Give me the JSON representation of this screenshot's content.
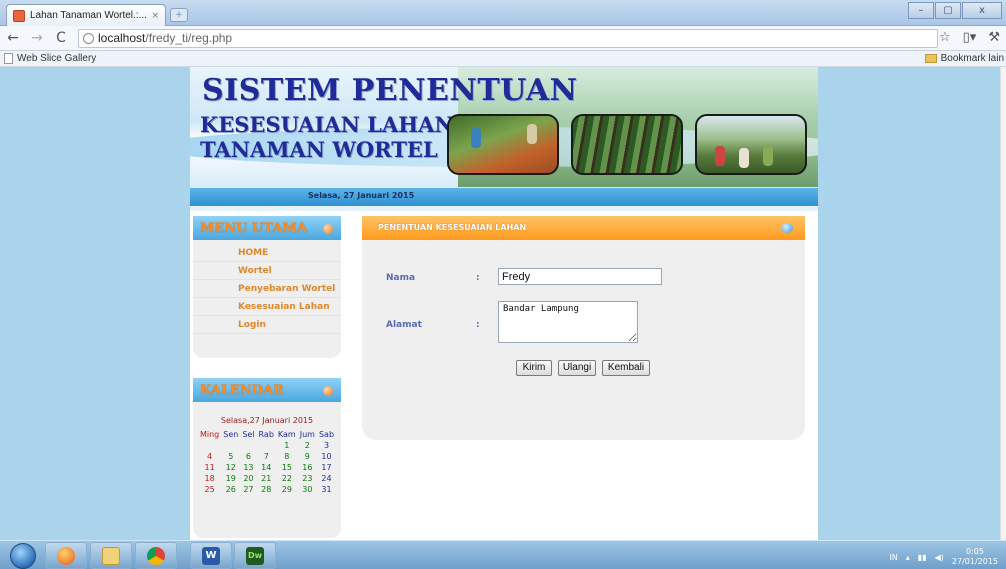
{
  "browser": {
    "tab_title": "Lahan Tanaman Wortel.:...",
    "tab_close": "×",
    "new_tab": "+",
    "window_controls": [
      "–",
      "▢",
      "x"
    ],
    "url_host": "localhost",
    "url_path": "/fredy_ti/reg.php",
    "bookmark_left": "Web Slice Gallery",
    "bookmark_right": "Bookmark lain"
  },
  "banner": {
    "title_line1": "SISTEM PENENTUAN",
    "title_line2": "KESESUAIAN LAHAN",
    "title_line3": "TANAMAN WORTEL",
    "date": "Selasa, 27 Januari 2015"
  },
  "menu": {
    "heading": "MENU UTAMA",
    "items": [
      {
        "label": "HOME"
      },
      {
        "label": "Wortel"
      },
      {
        "label": "Penyebaran Wortel"
      },
      {
        "label": "Kesesuaian Lahan"
      },
      {
        "label": "Login"
      }
    ]
  },
  "calendar": {
    "heading": "KALENDAR",
    "date_title": "Selasa,27 Januari 2015",
    "days": [
      "Ming",
      "Sen",
      "Sel",
      "Rab",
      "Kam",
      "Jum",
      "Sab"
    ],
    "weeks": [
      [
        "",
        "",
        "",
        "",
        "1",
        "2",
        "3"
      ],
      [
        "4",
        "5",
        "6",
        "7",
        "8",
        "9",
        "10"
      ],
      [
        "11",
        "12",
        "13",
        "14",
        "15",
        "16",
        "17"
      ],
      [
        "18",
        "19",
        "20",
        "21",
        "22",
        "23",
        "24"
      ],
      [
        "25",
        "26",
        "27",
        "28",
        "29",
        "30",
        "31"
      ]
    ]
  },
  "form": {
    "heading": "PENENTUAN KESESUAIAN LAHAN",
    "nama_label": "Nama",
    "alamat_label": "Alamat",
    "colon": ":",
    "nama_value": "Fredy",
    "alamat_value": "Bandar Lampung",
    "buttons": {
      "kirim": "Kirim",
      "ulangi": "Ulangi",
      "kembali": "Kembali"
    }
  },
  "taskbar": {
    "lang": "IN",
    "time": "0:05",
    "date": "27/01/2015",
    "apps": [
      "start-button",
      "firefox",
      "explorer",
      "chrome",
      "word",
      "dreamweaver"
    ]
  },
  "colors": {
    "page_bg": "#a9d4ec",
    "title_blue": "#1f2c97",
    "menu_orange": "#e0882c",
    "header_orange": "#ff9a1c",
    "header_blue": "#4aa7e0"
  }
}
